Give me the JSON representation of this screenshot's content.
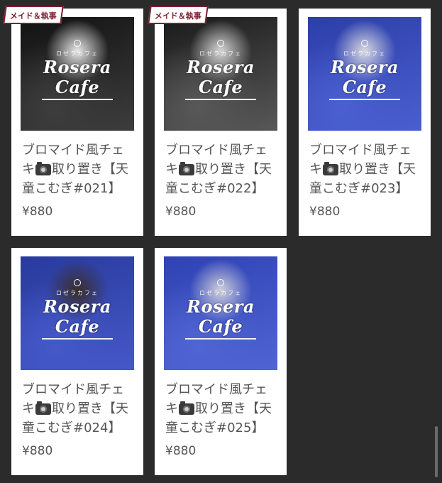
{
  "badge_text": "メイド＆執事",
  "logo": {
    "sub": "ロゼラカフェ",
    "main": "Rosera Cafe"
  },
  "products": [
    {
      "title_before": "ブロマイド風チェキ",
      "title_after": "取り置き【天童こむぎ#021】",
      "price": "¥880",
      "icon": "camera-icon",
      "has_badge": true,
      "photo_colors": [
        "#121212",
        "#3d3d3d",
        "#e8e8e8"
      ]
    },
    {
      "title_before": "ブロマイド風チェキ",
      "title_after": "取り置き【天童こむぎ#022】",
      "price": "¥880",
      "icon": "camera-icon",
      "has_badge": true,
      "photo_colors": [
        "#1a1a1a",
        "#585858",
        "#d6d6d6"
      ]
    },
    {
      "title_before": "ブロマイド風チェキ",
      "title_after": "取り置き【天童こむぎ#023】",
      "price": "¥880",
      "icon": "camera-icon",
      "has_badge": false,
      "photo_colors": [
        "#2c3ea8",
        "#4a5fd0",
        "#d8d8e0"
      ]
    },
    {
      "title_before": "ブロマイド風チェキ",
      "title_after": "取り置き【天童こむぎ#024】",
      "price": "¥880",
      "icon": "camera-icon",
      "has_badge": false,
      "photo_colors": [
        "#283a9c",
        "#4558c8",
        "#3a2e2a"
      ]
    },
    {
      "title_before": "ブロマイド風チェキ",
      "title_after": "取り置き【天童こむぎ#025】",
      "price": "¥880",
      "icon": "camera-icon",
      "has_badge": false,
      "photo_colors": [
        "#2e42b4",
        "#5064d2",
        "#cfcfd8"
      ]
    }
  ],
  "colors": {
    "page_background": "#2b2b2b",
    "card_background": "#ffffff",
    "text": "#555555",
    "badge_accent": "#7a1f2e"
  }
}
